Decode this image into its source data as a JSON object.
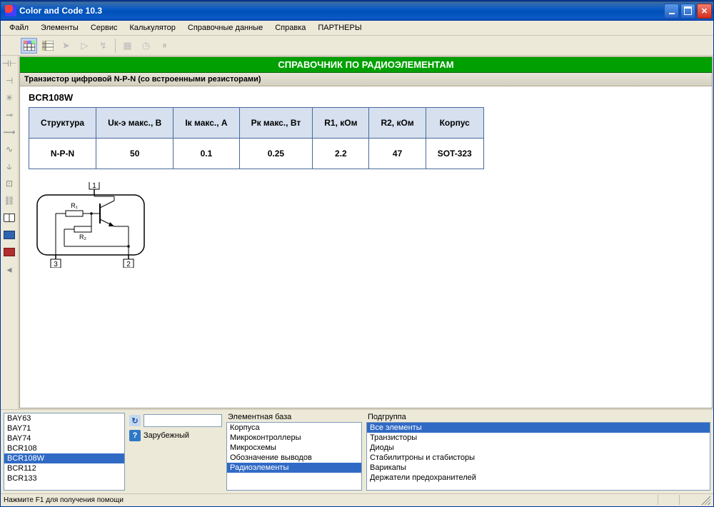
{
  "window": {
    "title": "Color and Code 10.3"
  },
  "menu": {
    "items": [
      "Файл",
      "Элементы",
      "Сервис",
      "Калькулятор",
      "Справочные данные",
      "Справка",
      "ПАРТНЕРЫ"
    ]
  },
  "reference": {
    "header": "СПРАВОЧНИК ПО РАДИОЭЛЕМЕНТАМ",
    "subheader": "Транзистор цифровой N-P-N (со встроенными резисторами)",
    "part_name": "BCR108W",
    "table": {
      "headers": [
        "Структура",
        "Uк-э макс., В",
        "Iк макс., А",
        "Pк макс., Вт",
        "R1, кОм",
        "R2, кОм",
        "Корпус"
      ],
      "row": [
        "N-P-N",
        "50",
        "0.1",
        "0.25",
        "2.2",
        "47",
        "SOT-323"
      ]
    }
  },
  "bottom": {
    "parts_list": [
      "BAY63",
      "BAY71",
      "BAY74",
      "BCR108",
      "BCR108W",
      "BCR112",
      "BCR133"
    ],
    "parts_selected": "BCR108W",
    "origin_label": "Зарубежный",
    "base_label": "Элементная база",
    "base_items": [
      "Корпуса",
      "Микроконтроллеры",
      "Микросхемы",
      "Обозначение выводов",
      "Радиоэлементы"
    ],
    "base_selected": "Радиоэлементы",
    "subgroup_label": "Подгруппа",
    "subgroup_items": [
      "Все элементы",
      "Транзисторы",
      "Диоды",
      "Стабилитроны и стабисторы",
      "Варикапы",
      "Держатели предохранителей"
    ],
    "subgroup_selected": "Все элементы"
  },
  "statusbar": {
    "help": "Нажмите F1 для получения помощи"
  }
}
